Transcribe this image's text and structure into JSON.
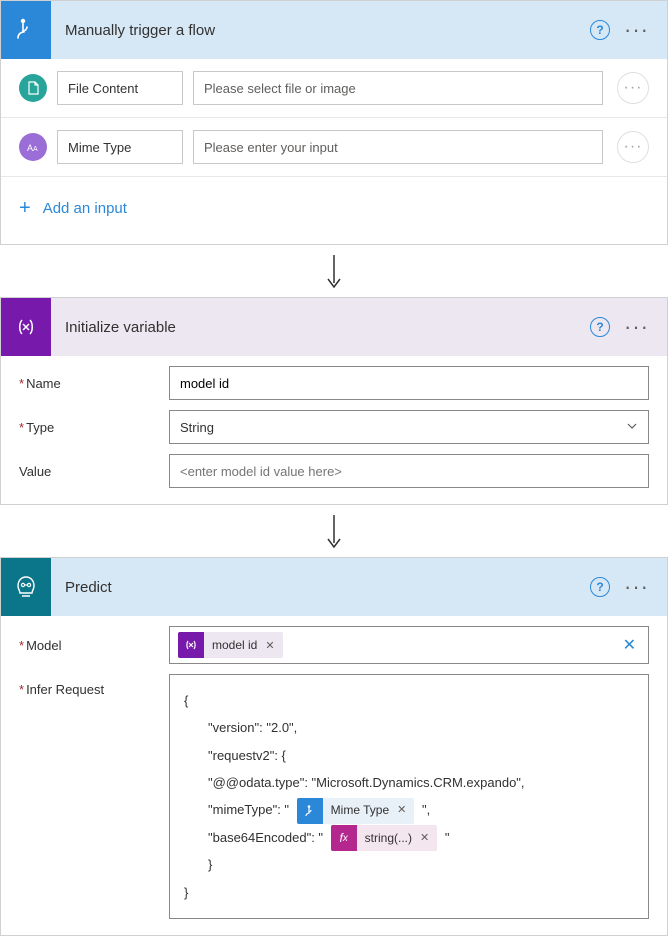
{
  "trigger": {
    "title": "Manually trigger a flow",
    "inputs": [
      {
        "label": "File Content",
        "placeholder": "Please select file or image"
      },
      {
        "label": "Mime Type",
        "placeholder": "Please enter your input"
      }
    ],
    "add_label": "Add an input"
  },
  "variable": {
    "title": "Initialize variable",
    "name_label": "Name",
    "name_value": "model id",
    "type_label": "Type",
    "type_value": "String",
    "value_label": "Value",
    "value_placeholder": "<enter model id value here>"
  },
  "predict": {
    "title": "Predict",
    "model_label": "Model",
    "model_token": "model id",
    "infer_label": "Infer Request",
    "json": {
      "open": "{",
      "version": "\"version\": \"2.0\",",
      "req": "\"requestv2\": {",
      "odata": "\"@@odata.type\": \"Microsoft.Dynamics.CRM.expando\",",
      "mime_pre": "\"mimeType\": \"",
      "mime_token": "Mime Type",
      "mime_post": "\",",
      "b64_pre": "\"base64Encoded\": \"",
      "b64_token": "string(...)",
      "b64_post": "\"",
      "close_inner": "}",
      "close": "}"
    }
  }
}
